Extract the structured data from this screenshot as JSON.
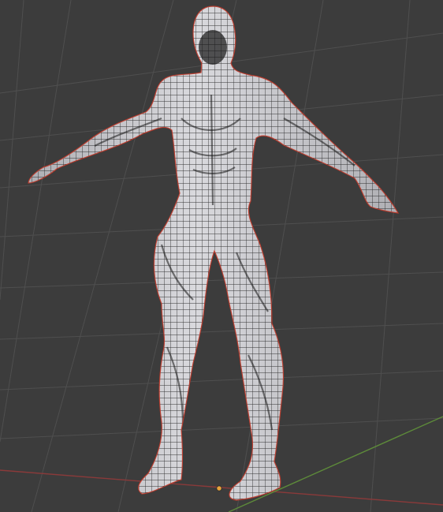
{
  "viewport": {
    "background_color": "#3c3c3c",
    "grid_color": "#4f4f4f",
    "x_axis_color": "#8a3a3a",
    "y_axis_color": "#5d8a3a",
    "origin_color": "#e8a33a"
  },
  "mesh": {
    "object": "humanoid-figure",
    "display_mode": "wireframe-over-solid",
    "surface_color": "#d9d9dd",
    "shadow_color": "#8c8c92",
    "wire_color": "#151515",
    "seam_color": "#c23a2a"
  }
}
